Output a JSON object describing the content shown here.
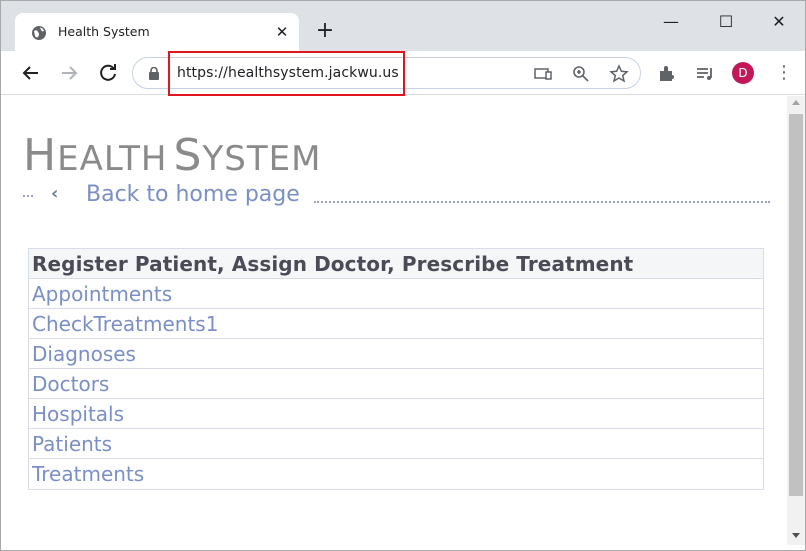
{
  "browser": {
    "tab_title": "Health System",
    "new_tab_glyph": "+",
    "close_tab_glyph": "✕",
    "url": "https://healthsystem.jackwu.us",
    "profile_initial": "D",
    "profile_color": "#c2185b",
    "highlight_color": "#e0161e",
    "window_controls": {
      "minimize": "—",
      "maximize": "☐",
      "close": "✕"
    }
  },
  "page": {
    "title_first_big": "H",
    "title_first_rest": "EALTH",
    "title_second_big": "S",
    "title_second_rest": "YSTEM",
    "back_link": "Back to home page",
    "back_arrow": "‹",
    "table": {
      "header": "Register Patient, Assign Doctor, Prescribe Treatment",
      "links": [
        "Appointments",
        "CheckTreatments1",
        "Diagnoses",
        "Doctors",
        "Hospitals",
        "Patients",
        "Treatments"
      ]
    },
    "link_color": "#7b8fc7",
    "title_color": "#8a8a8a"
  }
}
